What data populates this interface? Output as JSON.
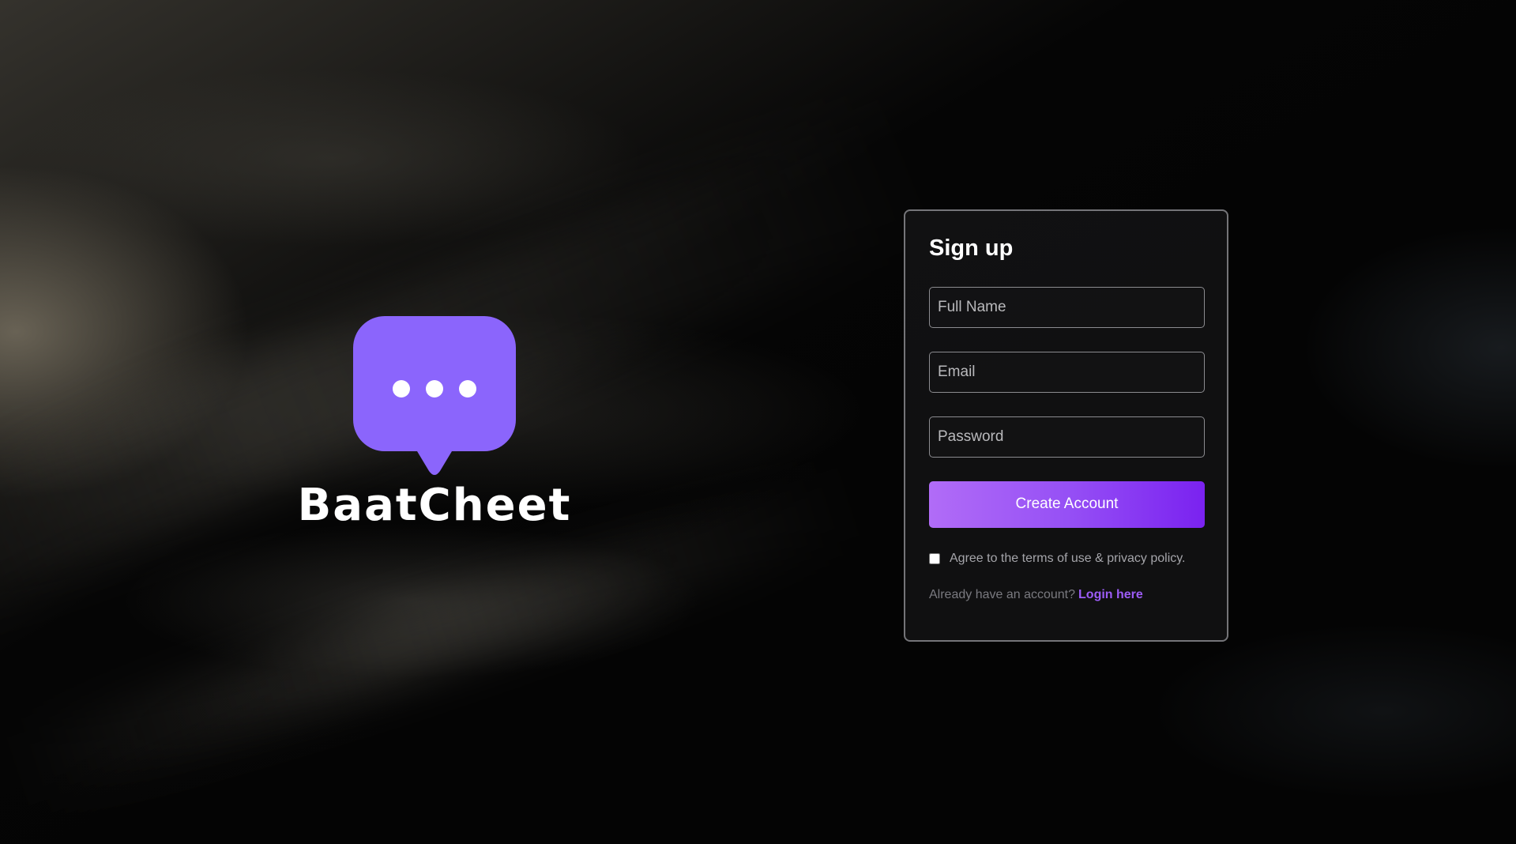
{
  "brand": {
    "name": "BaatCheet",
    "logo_icon": "chat-bubble-icon",
    "accent_color": "#8b65fc"
  },
  "signup": {
    "title": "Sign up",
    "full_name_placeholder": "Full Name",
    "email_placeholder": "Email",
    "password_placeholder": "Password",
    "submit_label": "Create Account",
    "terms_label": "Agree to the terms of use & privacy policy.",
    "login_prompt": "Already have an account?",
    "login_link": "Login here"
  },
  "colors": {
    "button_gradient_start": "#b16cf7",
    "button_gradient_end": "#7a22f0",
    "link": "#9c5cf6",
    "background": "#040404"
  }
}
